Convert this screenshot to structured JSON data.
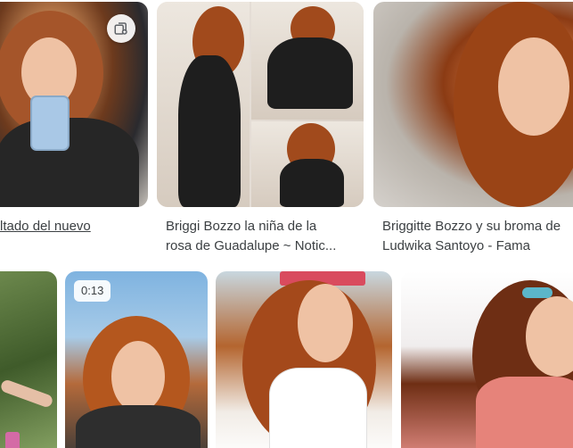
{
  "results": [
    {
      "caption_line1": "ltado del nuevo",
      "caption_line2": ""
    },
    {
      "caption_line1": "Briggi Bozzo la niña de la",
      "caption_line2": "rosa de Guadalupe ~ Notic..."
    },
    {
      "caption_line1": "Briggitte Bozzo y su broma de",
      "caption_line2": "Ludwika Santoyo - Fama"
    }
  ],
  "second_row": {
    "video_duration": "0:13"
  },
  "icons": {
    "similar_images_icon": "copy-add-icon"
  }
}
